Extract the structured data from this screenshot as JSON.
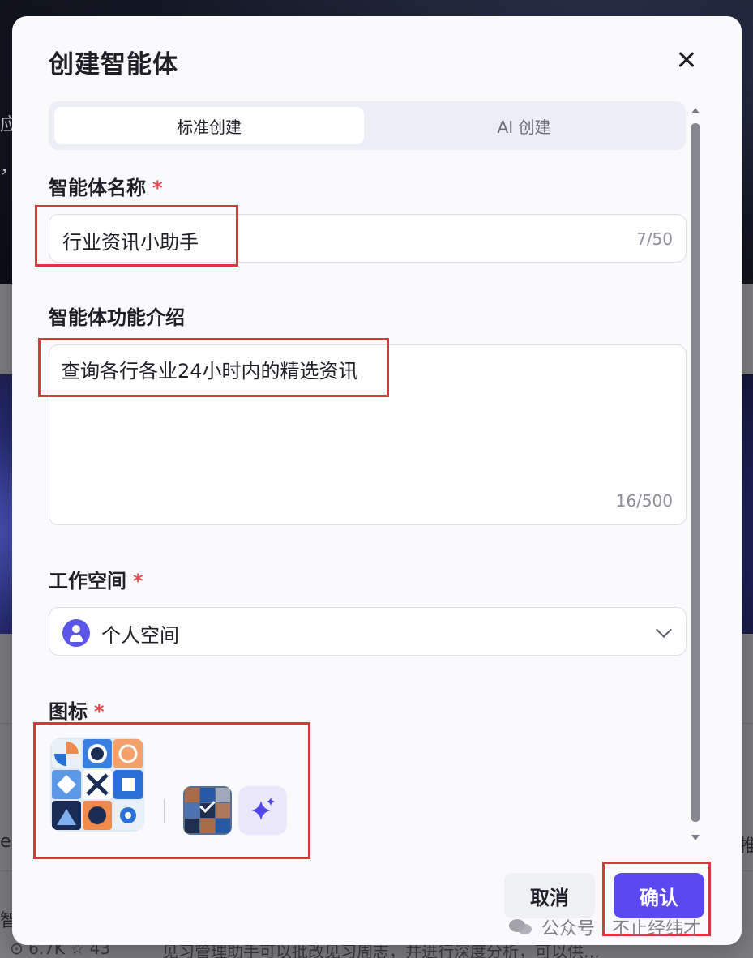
{
  "background": {
    "snippet_a": "应",
    "snippet_b": "，",
    "snippet_c": "er",
    "snippet_d": "推",
    "snippet_e": "智",
    "stats": "⊙ 6.7K  ☆ 43",
    "description": "见习管理助手可以批改见习周志，并进行深度分析，可以供…"
  },
  "modal": {
    "title": "创建智能体",
    "tabs": [
      {
        "label": "标准创建",
        "active": true
      },
      {
        "label": "AI 创建",
        "active": false
      }
    ],
    "name_field": {
      "label": "智能体名称",
      "required_mark": "*",
      "value": "行业资讯小助手",
      "counter": "7/50"
    },
    "intro_field": {
      "label": "智能体功能介绍",
      "value": "查询各行各业24小时内的精选资讯",
      "counter": "16/500"
    },
    "workspace_field": {
      "label": "工作空间",
      "required_mark": "*",
      "selected": "个人空间"
    },
    "icon_field": {
      "label": "图标",
      "required_mark": "*"
    },
    "buttons": {
      "cancel": "取消",
      "confirm": "确认"
    }
  },
  "watermark": "公众号 · 不止经纬才",
  "icons": {
    "close": "close-icon",
    "user": "user-icon",
    "chevron": "chevron-down-icon",
    "sparkle": "sparkle-icon",
    "check": "check-icon"
  },
  "colors": {
    "accent": "#5a48f0",
    "required": "#e5484d",
    "annotation": "#d9363e"
  }
}
